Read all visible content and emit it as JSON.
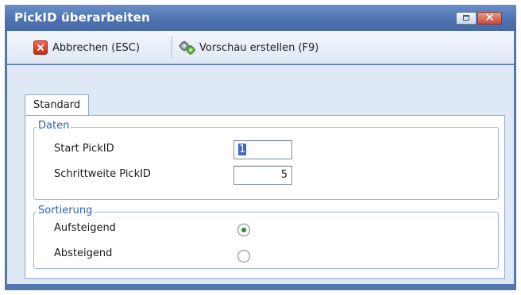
{
  "window": {
    "title": "PickID überarbeiten",
    "accent": "#4e73b0"
  },
  "toolbar": {
    "cancel_label": "Abbrechen (ESC)",
    "cancel_icon": "cancel-x-icon",
    "preview_label": "Vorschau erstellen (F9)",
    "preview_icon": "gears-icon"
  },
  "tabs": [
    {
      "label": "Standard",
      "selected": true
    }
  ],
  "daten": {
    "legend": "Daten",
    "start_label": "Start PickID",
    "start_value": "1",
    "step_label": "Schrittweite PickID",
    "step_value": "5"
  },
  "sortierung": {
    "legend": "Sortierung",
    "options": [
      {
        "label": "Aufsteigend",
        "selected": true
      },
      {
        "label": "Absteigend",
        "selected": false
      }
    ]
  }
}
